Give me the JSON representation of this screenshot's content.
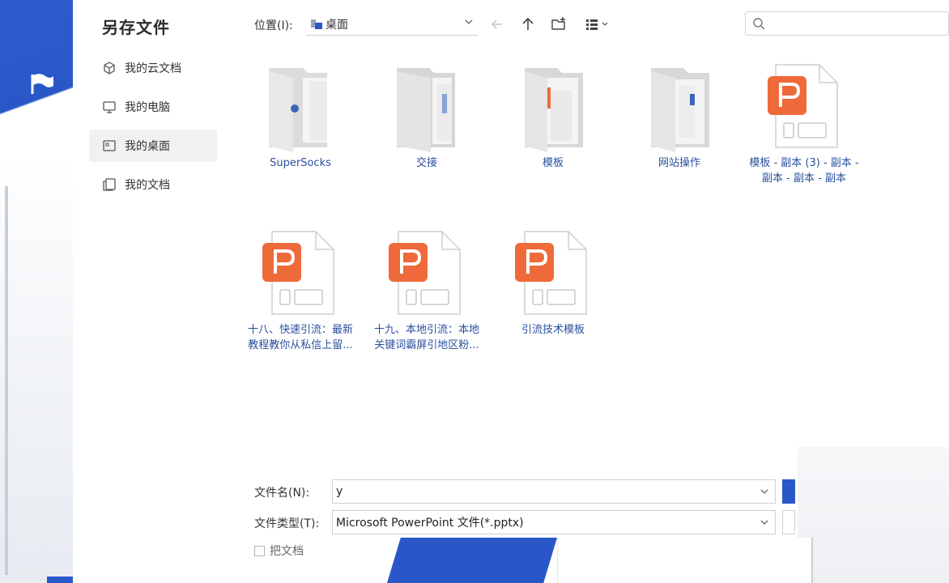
{
  "dialog": {
    "title": "另存文件"
  },
  "sidebar": {
    "items": [
      {
        "label": "我的云文档",
        "icon": "cloud-cube-icon",
        "active": false
      },
      {
        "label": "我的电脑",
        "icon": "monitor-icon",
        "active": false
      },
      {
        "label": "我的桌面",
        "icon": "desktop-icon",
        "active": true
      },
      {
        "label": "我的文档",
        "icon": "documents-icon",
        "active": false
      }
    ]
  },
  "toolbar": {
    "location_label": "位置(I):",
    "location_value": "桌面",
    "search_placeholder": ""
  },
  "files": [
    {
      "name": "SuperSocks",
      "type": "folder"
    },
    {
      "name": "交接",
      "type": "folder"
    },
    {
      "name": "模板",
      "type": "folder"
    },
    {
      "name": "网站操作",
      "type": "folder"
    },
    {
      "name": "模板 - 副本 (3) - 副本 - 副本 - 副本 - 副本",
      "type": "pptx"
    },
    {
      "name": "十八、快速引流：最新教程教你从私信上留...",
      "type": "pptx"
    },
    {
      "name": "十九、本地引流：本地关键词霸屏引地区粉...",
      "type": "pptx"
    },
    {
      "name": "引流技术模板",
      "type": "pptx"
    }
  ],
  "form": {
    "filename_label": "文件名(N):",
    "filename_value": "y",
    "filetype_label": "文件类型(T):",
    "filetype_value": "Microsoft PowerPoint 文件(*.pptx)",
    "checkbox_label": "把文档"
  },
  "colors": {
    "accent": "#2a57c8",
    "pptx_orange": "#ef6a3a",
    "file_name": "#2b4f9e"
  }
}
